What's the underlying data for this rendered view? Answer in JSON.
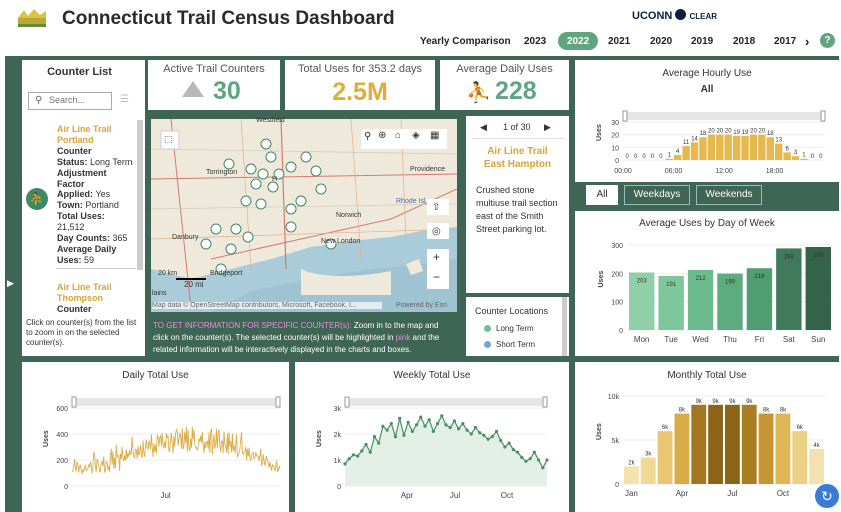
{
  "header": {
    "title": "Connecticut Trail Census Dashboard",
    "brand": "UCONN",
    "brand2": "CLEAR",
    "yearly_comparison": "Yearly Comparison",
    "years": [
      "2023",
      "2022",
      "2021",
      "2020",
      "2019",
      "2018",
      "2017"
    ],
    "active_year": "2022",
    "more": "›",
    "help": "?"
  },
  "counter_list": {
    "title": "Counter List",
    "search_placeholder": "Search...",
    "item1": {
      "title1": "Air Line Trail",
      "title2": "Portland",
      "l1": "Counter",
      "l2": "Status: ",
      "l2v": "Long Term",
      "l3": "Adjustment",
      "l4": "Factor",
      "l5": "Applied: ",
      "l5v": "Yes",
      "l6": "Town: ",
      "l6v": "Portland",
      "l7": "Total Uses:",
      "l8": "21,512",
      "l9": "Day Counts: ",
      "l9v": "365",
      "l10": "Average Daily",
      "l11": "Uses: ",
      "l11v": "59"
    },
    "item2": {
      "title1": "Air Line Trail",
      "title2": "Thompson",
      "l1": "Counter"
    },
    "hint": "Click on counter(s) from the list to zoom in on the selected counter(s)."
  },
  "kpis": {
    "active_label": "Active Trail Counters",
    "active_value": "30",
    "total_label": "Total Uses for 353.2 days",
    "total_value": "2.5M",
    "avg_label": "Average Daily Uses",
    "avg_value": "228"
  },
  "map": {
    "labels": {
      "westfield": "Westfield",
      "torrington": "Torrington",
      "providence": "Providence",
      "rhode": "Rhode Isl",
      "norwich": "Norwich",
      "danbury": "Danbury",
      "bridgeport": "Bridgeport",
      "new_london": "New London",
      "h": "H",
      "attrib": "Map data © OpenStreetMap contributors, Microsoft, Facebook, I...",
      "powered": "Powered by Esri",
      "scale_mi": "20 mi",
      "scale_km": "20 km",
      "plains": "lains"
    },
    "info": "TO GET INFORMATION FOR SPECIFIC COUNTER(s): Zoom in to the map and click on the counter(s). The selected counter(s) will be highlighted in pink and the related information will be interactively displayed in the charts and boxes.",
    "info_a": "TO GET INFORMATION FOR SPECIFIC COUNTER(s):",
    "info_b": " Zoom in to the map and click on the counter(s). The selected counter(s) will be highlighted in ",
    "info_pink": "pink",
    "info_c": " and the related information will be interactively displayed in the charts and boxes."
  },
  "popup": {
    "pager": "1 of 30",
    "prev": "◀",
    "next": "▶",
    "title1": "Air Line Trail",
    "title2": "East Hampton",
    "desc": "Crushed stone multiuse trail section east of the Smith Street parking lot."
  },
  "locations": {
    "title": "Counter Locations",
    "long": "Long Term",
    "short": "Short Term"
  },
  "hourly": {
    "title": "Average Hourly Use",
    "subtitle": "All",
    "ylabel": "Uses",
    "tabs": [
      "All",
      "Weekdays",
      "Weekends"
    ],
    "active_tab": "All",
    "yticks": [
      "0",
      "10",
      "20",
      "30"
    ],
    "xticks": [
      "00:00",
      "06:00",
      "12:00",
      "18:00"
    ]
  },
  "dow": {
    "title": "Average Uses by Day of Week",
    "ylabel": "Uses",
    "yticks": [
      "0",
      "100",
      "200",
      "300"
    ]
  },
  "daily": {
    "title": "Daily Total Use",
    "ylabel": "Uses",
    "yticks": [
      "0",
      "200",
      "400",
      "600"
    ],
    "xtick": "Jul"
  },
  "weekly": {
    "title": "Weekly Total Use",
    "ylabel": "Uses",
    "yticks": [
      "0",
      "1k",
      "2k",
      "3k"
    ],
    "xticks": [
      "Apr",
      "Jul",
      "Oct"
    ]
  },
  "monthly": {
    "title": "Monthly Total Use",
    "ylabel": "Uses",
    "yticks": [
      "0",
      "5k",
      "10k"
    ]
  },
  "colors": {
    "green": "#3f6555",
    "accent": "#5fa582",
    "gold": "#e0ac3b",
    "pink": "#e88de0"
  },
  "chart_data": [
    {
      "type": "bar",
      "title": "Average Hourly Use",
      "x": [
        "0",
        "1",
        "2",
        "3",
        "4",
        "5",
        "6",
        "7",
        "8",
        "9",
        "10",
        "11",
        "12",
        "13",
        "14",
        "15",
        "16",
        "17",
        "18",
        "19",
        "20",
        "21",
        "22",
        "23"
      ],
      "values": [
        0,
        0,
        0,
        0,
        0,
        1,
        4,
        11,
        14,
        18,
        20,
        20,
        20,
        19,
        19,
        20,
        20,
        18,
        13,
        6,
        3,
        1,
        0,
        0
      ],
      "ylim": [
        0,
        30
      ]
    },
    {
      "type": "bar",
      "title": "Average Uses by Day of Week",
      "categories": [
        "Mon",
        "Tue",
        "Wed",
        "Thu",
        "Fri",
        "Sat",
        "Sun"
      ],
      "values": [
        203,
        191,
        212,
        199,
        218,
        288,
        293
      ],
      "ylim": [
        0,
        300
      ]
    },
    {
      "type": "line",
      "title": "Daily Total Use",
      "values": [
        105,
        116,
        148,
        207,
        144,
        113,
        185,
        172,
        104,
        151,
        159,
        124,
        91,
        125,
        112,
        137,
        155,
        118,
        125,
        132,
        166,
        148,
        181,
        162,
        98,
        143,
        258,
        249,
        156,
        105,
        211,
        188,
        165,
        110,
        115,
        172,
        192,
        154,
        227,
        103,
        120,
        188,
        183,
        122,
        155,
        111,
        223,
        288,
        164,
        267,
        136,
        220,
        135,
        318,
        221,
        235,
        231,
        117,
        247,
        206,
        301,
        216,
        191,
        233,
        195,
        284,
        208,
        255,
        222,
        277,
        242,
        251,
        381,
        276,
        224,
        216,
        283,
        279,
        209,
        308,
        235,
        254,
        316,
        242,
        217,
        350,
        255,
        225,
        309,
        356,
        294,
        282,
        348,
        325,
        282,
        396,
        301,
        223,
        329,
        264,
        314,
        247,
        391,
        379,
        303,
        371,
        390,
        311,
        408,
        295,
        292,
        344,
        292,
        407,
        373,
        383,
        271,
        265,
        363,
        408,
        330,
        251,
        384,
        305,
        399,
        434,
        418,
        309,
        362,
        405,
        389,
        285,
        446,
        282,
        306,
        414,
        329,
        456,
        262,
        434,
        294,
        269,
        366,
        294,
        456,
        356,
        431,
        326,
        293,
        295,
        278,
        299,
        365,
        341,
        387,
        330,
        418,
        317,
        254,
        340,
        292,
        339,
        344,
        286,
        413,
        254,
        420,
        442,
        239,
        337,
        398,
        288,
        319,
        440,
        290,
        405,
        434,
        313,
        259,
        347,
        343,
        252,
        418,
        322,
        306,
        261,
        403,
        245,
        417,
        302,
        344,
        257,
        406,
        271,
        313,
        252,
        310,
        401,
        220,
        241,
        253,
        281,
        352,
        416,
        255,
        245,
        262,
        264,
        300,
        198,
        284,
        229,
        296,
        217,
        194,
        236,
        253,
        258,
        209,
        218,
        261,
        238,
        229,
        231,
        192,
        233,
        287,
        161,
        174,
        245,
        193,
        154,
        204,
        230,
        188,
        186,
        140,
        185,
        150,
        117,
        163,
        154,
        145,
        114,
        162,
        195,
        112,
        120,
        148,
        133
      ],
      "ylim": [
        0,
        600
      ]
    },
    {
      "type": "area",
      "title": "Weekly Total Use",
      "values": [
        850,
        1050,
        1200,
        1150,
        1350,
        1600,
        1300,
        1900,
        1650,
        2300,
        2150,
        2400,
        1900,
        2600,
        1950,
        2450,
        2100,
        2350,
        2650,
        2300,
        2550,
        2100,
        2400,
        2700,
        2350,
        2250,
        2500,
        2200,
        2400,
        2150,
        2000,
        2250,
        2050,
        1950,
        1800,
        1900,
        2100,
        1750,
        1500,
        1650,
        1400,
        1300,
        1100,
        950,
        1050,
        1300,
        1000,
        700,
        1000
      ],
      "ylim": [
        0,
        3000
      ]
    },
    {
      "type": "bar",
      "title": "Monthly Total Use",
      "categories": [
        "Jan",
        "Feb",
        "Mar",
        "Apr",
        "May",
        "Jun",
        "Jul",
        "Aug",
        "Sep",
        "Oct",
        "Nov",
        "Dec"
      ],
      "values": [
        2,
        3,
        6,
        8,
        9,
        9,
        9,
        9,
        8,
        8,
        6,
        4
      ],
      "ylim": [
        0,
        10
      ]
    }
  ]
}
